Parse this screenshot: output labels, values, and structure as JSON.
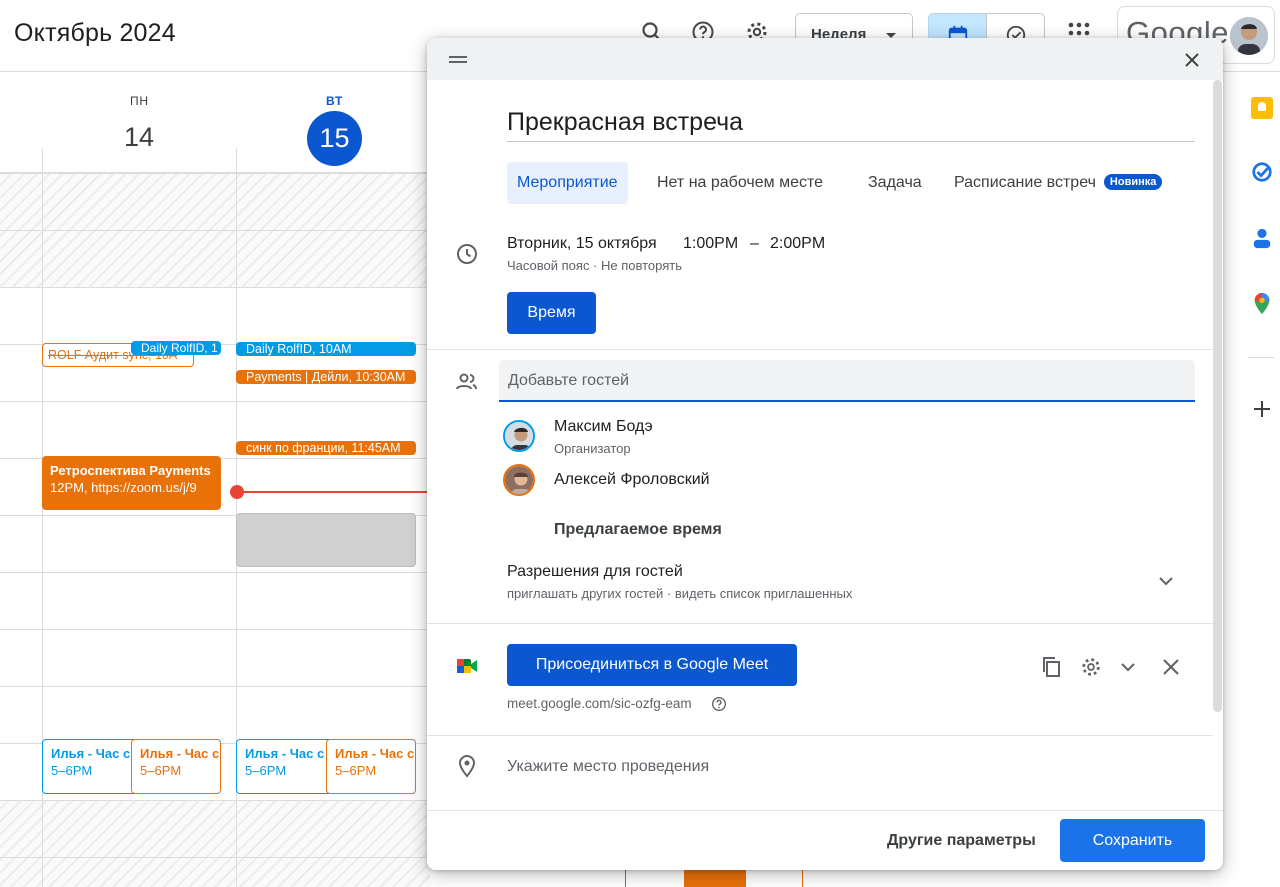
{
  "header": {
    "month_title": "Октябрь 2024",
    "view_label": "Неделя",
    "logo_text": "Google"
  },
  "calendar": {
    "days": [
      {
        "name": "ПН",
        "number": "14"
      },
      {
        "name": "ВТ",
        "number": "15",
        "today": true
      }
    ],
    "events": [
      {
        "id": "rolf",
        "label": "ROLF Аудит sync, 10A",
        "color": "#e8710a"
      },
      {
        "id": "daily-mon",
        "label": "Daily RolfID, 1",
        "color": "#039be5"
      },
      {
        "id": "daily-tue",
        "label": "Daily RolfID, 10AM",
        "color": "#039be5"
      },
      {
        "id": "payments",
        "label": "Payments | Дейли, 10:30AM",
        "color": "#e8710a"
      },
      {
        "id": "sink",
        "label": "синк по франции, 11:45AM",
        "color": "#e8710a"
      },
      {
        "id": "retro",
        "title": "Ретроспектива Payments",
        "subtitle": "12PM, https://zoom.us/j/9",
        "color": "#e8710a"
      },
      {
        "id": "ilya-1",
        "title": "Илья - Час с",
        "subtitle": "5–6PM",
        "color": "#039be5"
      },
      {
        "id": "ilya-2",
        "title": "Илья - Час с",
        "subtitle": "5–6PM",
        "color": "#e8710a"
      },
      {
        "id": "ilya-3",
        "title": "Илья - Час с",
        "subtitle": "5–6PM",
        "color": "#039be5"
      },
      {
        "id": "ilya-4",
        "title": "Илья - Час с",
        "subtitle": "5–6PM",
        "color": "#e8710a"
      }
    ],
    "now_line_color": "#ea4335"
  },
  "dialog": {
    "title": "Прекрасная встреча",
    "tabs": [
      {
        "label": "Мероприятие",
        "active": true
      },
      {
        "label": "Нет на рабочем месте"
      },
      {
        "label": "Задача"
      },
      {
        "label": "Расписание встреч"
      }
    ],
    "new_badge": "Новинка",
    "date": "Вторник, 15 октября",
    "time_start": "1:00PM",
    "time_dash": "–",
    "time_end": "2:00PM",
    "tz_repeat": "Часовой пояс · Не повторять",
    "time_button": "Время",
    "guests_placeholder": "Добавьте гостей",
    "guests": [
      {
        "name": "Максим Бодэ",
        "role": "Организатор"
      },
      {
        "name": "Алексей Фроловский",
        "role": ""
      }
    ],
    "suggested_time": "Предлагаемое время",
    "permissions_title": "Разрешения для гостей",
    "permissions_sub": "приглашать других гостей · видеть список приглашенных",
    "meet_button": "Присоединиться в Google Meet",
    "meet_link": "meet.google.com/sic-ozfg-eam",
    "location_placeholder": "Укажите место проведения",
    "more_options": "Другие параметры",
    "save": "Сохранить"
  },
  "colors": {
    "accent": "#0b57d0",
    "orange": "#e8710a",
    "blue_event": "#039be5"
  }
}
